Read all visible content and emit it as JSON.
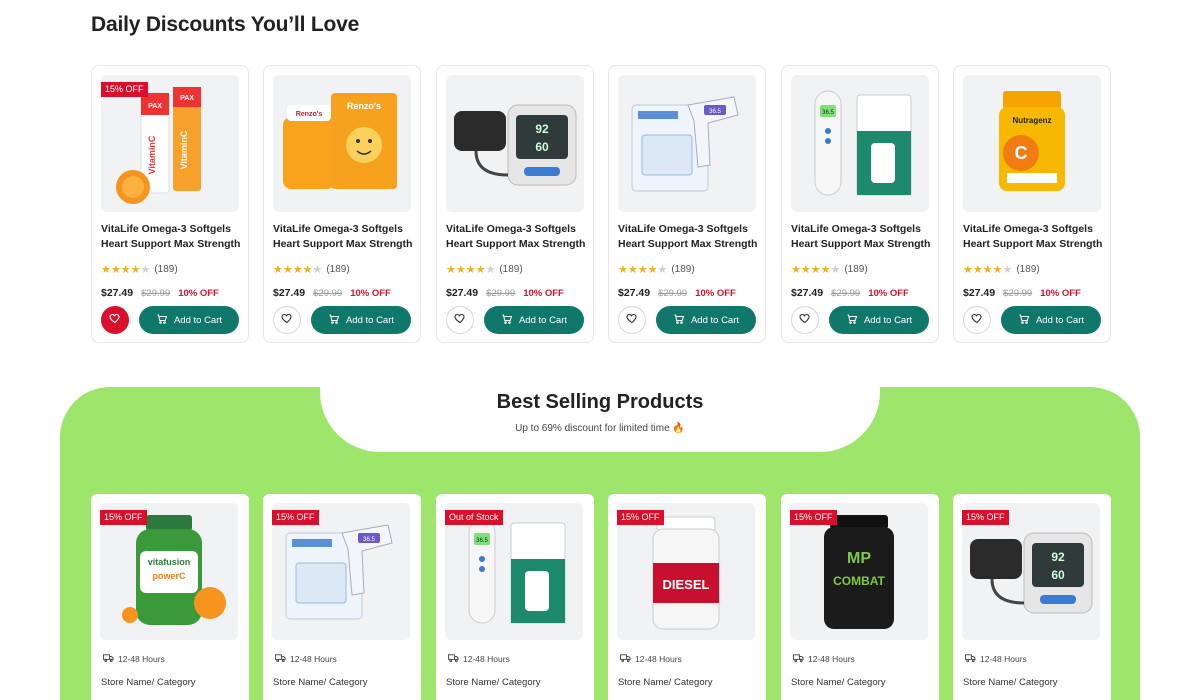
{
  "daily": {
    "title": "Daily Discounts You’ll Love",
    "products": [
      {
        "badge": "15% OFF",
        "name": "VitaLife Omega-3 Softgels Heart Support Max Strength",
        "count": "(189)",
        "price": "$27.49",
        "old": "$29.99",
        "off": "10% OFF",
        "cart": "Add to Cart",
        "wish_active": true
      },
      {
        "badge": "",
        "name": "VitaLife Omega-3 Softgels Heart Support Max Strength",
        "count": "(189)",
        "price": "$27.49",
        "old": "$29.99",
        "off": "10% OFF",
        "cart": "Add to Cart",
        "wish_active": false
      },
      {
        "badge": "",
        "name": "VitaLife Omega-3 Softgels Heart Support Max Strength",
        "count": "(189)",
        "price": "$27.49",
        "old": "$29.99",
        "off": "10% OFF",
        "cart": "Add to Cart",
        "wish_active": false
      },
      {
        "badge": "",
        "name": "VitaLife Omega-3 Softgels Heart Support Max Strength",
        "count": "(189)",
        "price": "$27.49",
        "old": "$29.99",
        "off": "10% OFF",
        "cart": "Add to Cart",
        "wish_active": false
      },
      {
        "badge": "",
        "name": "VitaLife Omega-3 Softgels Heart Support Max Strength",
        "count": "(189)",
        "price": "$27.49",
        "old": "$29.99",
        "off": "10% OFF",
        "cart": "Add to Cart",
        "wish_active": false
      },
      {
        "badge": "",
        "name": "VitaLife Omega-3 Softgels Heart Support Max Strength",
        "count": "(189)",
        "price": "$27.49",
        "old": "$29.99",
        "off": "10% OFF",
        "cart": "Add to Cart",
        "wish_active": false
      }
    ],
    "images": [
      "vitamin-c-tubes-image",
      "vitamin-c-gummies-image",
      "blood-pressure-monitor-image",
      "infrared-thermometer-image",
      "digital-thermometer-image",
      "nutragenz-vitamin-c-image"
    ],
    "rating_stars": 4
  },
  "best": {
    "title": "Best Selling Products",
    "subtitle": "Up to 69% discount for limited time 🔥",
    "products": [
      {
        "badge": "15% OFF",
        "delivery": "12-48 Hours",
        "store": "Store Name/ Category"
      },
      {
        "badge": "15% OFF",
        "delivery": "12-48 Hours",
        "store": "Store Name/ Category"
      },
      {
        "badge": "Out of Stock",
        "delivery": "12-48 Hours",
        "store": "Store Name/ Category"
      },
      {
        "badge": "15% OFF",
        "delivery": "12-48 Hours",
        "store": "Store Name/ Category"
      },
      {
        "badge": "15% OFF",
        "delivery": "12-48 Hours",
        "store": "Store Name/ Category"
      },
      {
        "badge": "15% OFF",
        "delivery": "12-48 Hours",
        "store": "Store Name/ Category"
      }
    ],
    "images": [
      "vitafusion-powerc-image",
      "infrared-thermometer-image",
      "wellworks-thermometer-image",
      "diesel-protein-image",
      "combat-whey-image",
      "bp-monitor-image"
    ]
  },
  "colors": {
    "accent": "#10786a",
    "sale": "#d9102c",
    "green_band": "#9ee56b",
    "star": "#f2b01e"
  },
  "label_samples": {
    "vitamin_c": "VitaminC",
    "pax": "PAX",
    "renzos": "Renzo's",
    "nutragenz": "Nutragenz",
    "vitafusion": "vitafusion",
    "powerc": "powerC",
    "diesel": "DIESEL",
    "combat": "COMBAT",
    "bp_reading": "92",
    "bp_reading2": "60",
    "thermo_reading": "36.5"
  }
}
